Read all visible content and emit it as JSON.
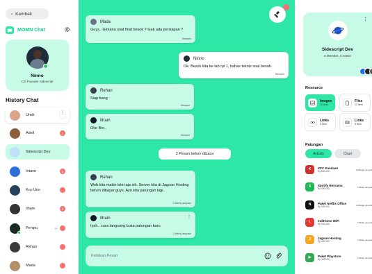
{
  "left": {
    "back_label": "Kembali",
    "brand_name": "MOMN Chat",
    "profile": {
      "name": "Ninno",
      "role": "CO-Founder Sidescript"
    },
    "history_title": "History Chat",
    "contacts": [
      {
        "name": "Umik",
        "badge": "",
        "pin": "",
        "online": false,
        "avatar": "#d9a58b"
      },
      {
        "name": "Adell",
        "badge": "2",
        "pin": "",
        "online": false,
        "avatar": "#8b5e3c"
      },
      {
        "name": "Sidescript Dev",
        "badge": "",
        "pin": "",
        "online": false,
        "avatar": "#bfe0f7"
      },
      {
        "name": "Intaxo",
        "badge": "5",
        "pin": "",
        "online": false,
        "avatar": "#2f6fd8"
      },
      {
        "name": "Kuy Uno",
        "badge": "",
        "pin": "",
        "online": false,
        "avatar": "#26415a"
      },
      {
        "name": "Ilham",
        "badge": "3",
        "pin": "",
        "online": false,
        "avatar": "#333333"
      },
      {
        "name": "Penipu",
        "badge": "",
        "pin": "9+",
        "online": true,
        "avatar": "#1b2a24"
      },
      {
        "name": "Rehan",
        "badge": "",
        "pin": "",
        "online": false,
        "avatar": "#3a3a3a"
      },
      {
        "name": "Mada",
        "badge": "",
        "pin": "",
        "online": false,
        "avatar": "#b59066"
      }
    ]
  },
  "chat": {
    "messages": [
      {
        "sender": "Mada",
        "text": "Guys.. Gimana soal final besok ? Gak ada persiapan ?",
        "time": "Kemarin",
        "side": "left"
      },
      {
        "sender": "Ninno",
        "text": "Ok. Besok kita ke lab rpl 1, bahas teknis soal besok.",
        "time": "Kemarin",
        "side": "right"
      },
      {
        "sender": "Rehan",
        "text": "Siap bang",
        "time": "Kemarin",
        "side": "left"
      },
      {
        "sender": "Ilham",
        "text": "Oke Bro..",
        "time": "Kemarin",
        "side": "left"
      },
      {
        "sender": "Rehan",
        "text": "Web kita makin lelet aja sih. Server kita di Jagoan Hosting belum dibayar guys. Ayo kita patungan lagi.",
        "time": "2 Menit yang lalu",
        "side": "left"
      },
      {
        "sender": "Ilham",
        "text": "Iyah.. cuss langsung buka patungan baru",
        "time": "1 Menit yang lalu",
        "side": "left"
      }
    ],
    "unread_label": "2 Pesan belum dibaca",
    "input_placeholder": "Ketikkan Pesan"
  },
  "right": {
    "group_name": "Sidescript Dev",
    "group_meta": "6 Member, 3 Admin",
    "resource_title": "Resource",
    "resources": [
      {
        "title": "Images",
        "sub": "10 Item"
      },
      {
        "title": "Files",
        "sub": "12 Item"
      },
      {
        "title": "Links",
        "sub": "5 Item"
      },
      {
        "title": "Links",
        "sub": "5 Item"
      }
    ],
    "patungan_title": "Patungan",
    "tabs": [
      "Activity",
      "Chart"
    ],
    "activities": [
      {
        "name": "KFC Pandaan",
        "price": "Rp 000.000,-",
        "time": "3 Minggu yang lalu",
        "color": "#d32f2f",
        "glyph": "K"
      },
      {
        "name": "Spotify Bersama",
        "price": "Rp 000.000,-",
        "time": "1 Bulan yang lalu",
        "color": "#1db954",
        "glyph": "S"
      },
      {
        "name": "Paket Netflix Office",
        "price": "Rp 000.000,-",
        "time": "3 Minggu yang lalu",
        "color": "#111111",
        "glyph": "N"
      },
      {
        "name": "IndiHome WiFi",
        "price": "Rp 000.000,-",
        "time": "1 Bulan yang lalu",
        "color": "#e53935",
        "glyph": "i"
      },
      {
        "name": "Jagoan Hosting",
        "price": "Rp 000.000,-",
        "time": "1 Bulan yang lalu",
        "color": "#f5a623",
        "glyph": "J"
      },
      {
        "name": "Paket Playstore",
        "price": "Rp 000.000,-",
        "time": "1 Bulan yang lalu",
        "color": "#34a853",
        "glyph": "▶"
      }
    ]
  }
}
